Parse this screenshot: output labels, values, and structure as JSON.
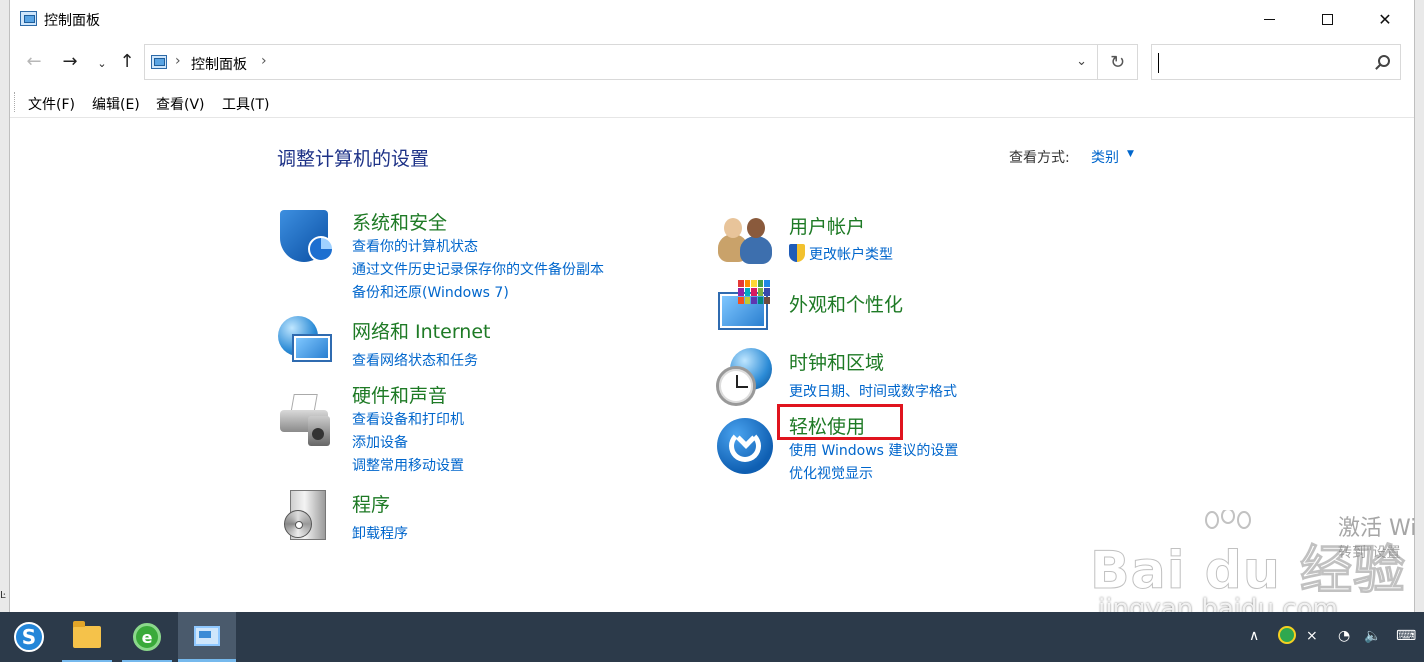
{
  "window": {
    "title": "控制面板",
    "minimize_label": "",
    "maximize_label": "",
    "close_label": "✕"
  },
  "nav": {
    "back": "←",
    "forward": "→",
    "history": "⌄",
    "up": "↑",
    "breadcrumb_sep": "›",
    "breadcrumb": "控制面板",
    "dropdown": "⌄",
    "refresh": "↻",
    "search_placeholder": ""
  },
  "menu": [
    "文件(F)",
    "编辑(E)",
    "查看(V)",
    "工具(T)"
  ],
  "main": {
    "heading": "调整计算机的设置",
    "view_by_label": "查看方式:",
    "view_by_value": "类别",
    "view_by_caret": "▼",
    "categories": [
      {
        "title": "系统和安全",
        "icon": "shield-icon",
        "links": [
          "查看你的计算机状态",
          "通过文件历史记录保存你的文件备份副本",
          "备份和还原(Windows 7)"
        ]
      },
      {
        "title": "网络和 Internet",
        "icon": "network-globe-icon",
        "links": [
          "查看网络状态和任务"
        ]
      },
      {
        "title": "硬件和声音",
        "icon": "printer-icon",
        "links": [
          "查看设备和打印机",
          "添加设备",
          "调整常用移动设置"
        ]
      },
      {
        "title": "程序",
        "icon": "programs-icon",
        "links": [
          "卸载程序"
        ]
      },
      {
        "title": "用户帐户",
        "icon": "users-icon",
        "links": [
          "更改帐户类型"
        ]
      },
      {
        "title": "外观和个性化",
        "icon": "appearance-icon",
        "links": []
      },
      {
        "title": "时钟和区域",
        "icon": "clock-globe-icon",
        "links": [
          "更改日期、时间或数字格式"
        ]
      },
      {
        "title": "轻松使用",
        "icon": "ease-of-access-icon",
        "links": [
          "使用 Windows 建议的设置",
          "优化视觉显示"
        ]
      }
    ]
  },
  "overlay": {
    "activate_title": "激活 Wi",
    "activate_sub": "转到\"设置",
    "watermark_brand": "Bai du 经验",
    "watermark_url": "jingyan.baidu.com"
  },
  "edge_fragment": "Ŀ",
  "taskbar": {
    "sogou_letter": "S",
    "ie_letter": "e",
    "tray_chevron": "∧",
    "tray_input": "⨯",
    "tray_wifi": "◔",
    "tray_volume": "🔈",
    "tray_keyboard": "⌨"
  },
  "colors": {
    "category_green": "#1e7a25",
    "link_blue": "#0066cc",
    "heading_blue": "#1e3287",
    "highlight_red": "#e0141e",
    "taskbar": "#2c3a4a"
  }
}
